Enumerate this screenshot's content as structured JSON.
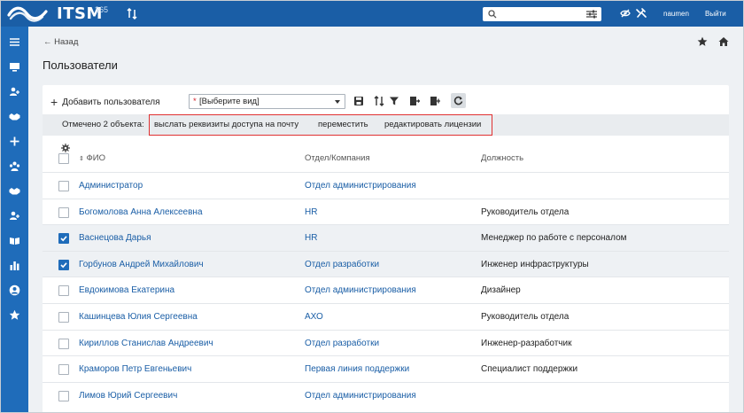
{
  "topbar": {
    "logo_text": "ITSM",
    "logo_sup": "365",
    "user": "naumen",
    "logout_label": "Выйти",
    "search_value": ""
  },
  "header": {
    "back_label": "← Назад",
    "title": "Пользователи"
  },
  "toolbar": {
    "add_label": "Добавить пользователя",
    "view_required_mark": "*",
    "view_placeholder": "[Выберите вид]"
  },
  "selection": {
    "count_label": "Отмечено 2 объекта:",
    "actions": [
      {
        "label": "выслать реквизиты доступа на почту"
      },
      {
        "label": "переместить"
      },
      {
        "label": "редактировать лицензии"
      }
    ]
  },
  "table": {
    "columns": {
      "name": "ФИО",
      "dept": "Отдел/Компания",
      "position": "Должность"
    },
    "rows": [
      {
        "name": "Администратор",
        "dept": "Отдел администрирования",
        "position": "",
        "checked": false
      },
      {
        "name": "Богомолова Анна Алексеевна",
        "dept": "HR",
        "position": "Руководитель отдела",
        "checked": false
      },
      {
        "name": "Васнецова Дарья",
        "dept": "HR",
        "position": "Менеджер по работе с персоналом",
        "checked": true
      },
      {
        "name": "Горбунов Андрей Михайлович",
        "dept": "Отдел разработки",
        "position": "Инженер инфраструктуры",
        "checked": true
      },
      {
        "name": "Евдокимова Екатерина",
        "dept": "Отдел администрирования",
        "position": "Дизайнер",
        "checked": false
      },
      {
        "name": "Кашинцева Юлия Сергеевна",
        "dept": "АХО",
        "position": "Руководитель отдела",
        "checked": false
      },
      {
        "name": "Кириллов Станислав Андреевич",
        "dept": "Отдел разработки",
        "position": "Инженер-разработчик",
        "checked": false
      },
      {
        "name": "Краморов Петр Евгеньевич",
        "dept": "Первая линия поддержки",
        "position": "Специалист поддержки",
        "checked": false
      },
      {
        "name": "Лимов Юрий Сергеевич",
        "dept": "Отдел администрирования",
        "position": "",
        "checked": false
      }
    ]
  },
  "colors": {
    "topbar": "#1a5ea6",
    "sidebar": "#1f6cba",
    "link": "#1a5ea6",
    "highlight_border": "#e03131"
  }
}
